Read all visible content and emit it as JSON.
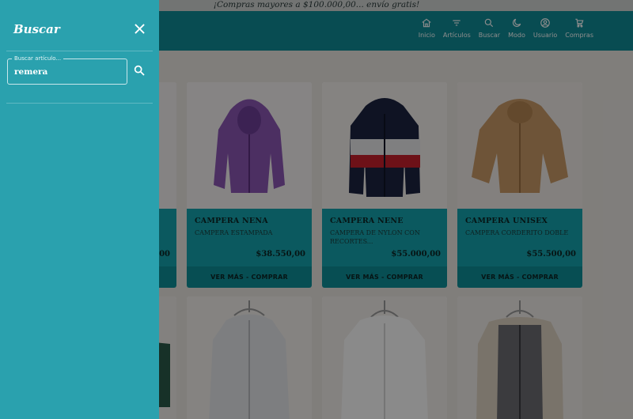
{
  "announcement": "¡Compras mayores a $100.000,00... envío gratis!",
  "nav": [
    {
      "label": "Inicio",
      "icon": "home-icon"
    },
    {
      "label": "Artículos",
      "icon": "filter-icon"
    },
    {
      "label": "Buscar",
      "icon": "search-icon"
    },
    {
      "label": "Modo",
      "icon": "moon-icon"
    },
    {
      "label": "Usuario",
      "icon": "user-icon"
    },
    {
      "label": "Compras",
      "icon": "cart-icon"
    }
  ],
  "products": [
    {
      "name": "",
      "desc": "",
      "price": "00",
      "button": "",
      "color": "#8c4a8e"
    },
    {
      "name": "CAMPERA NENA",
      "desc": "CAMPERA ESTAMPADA",
      "price": "$38.550,00",
      "button": "VER MÁS - COMPRAR",
      "color": "#8a56b2"
    },
    {
      "name": "CAMPERA NENE",
      "desc": "CAMPERA DE NYLON CON RECORTES...",
      "price": "$55.000,00",
      "button": "VER MÁS - COMPRAR",
      "color": "#1c2440"
    },
    {
      "name": "CAMPERA UNISEX",
      "desc": "CAMPERA CORDERITO DOBLE",
      "price": "$55.500,00",
      "button": "VER MÁS - COMPRAR",
      "color": "#c99a66"
    }
  ],
  "drawer": {
    "title": "Buscar",
    "search_label": "Buscar artículo...",
    "search_value": "remera"
  },
  "colors": {
    "accent": "#2aa1ae",
    "header": "#0f8a95"
  }
}
